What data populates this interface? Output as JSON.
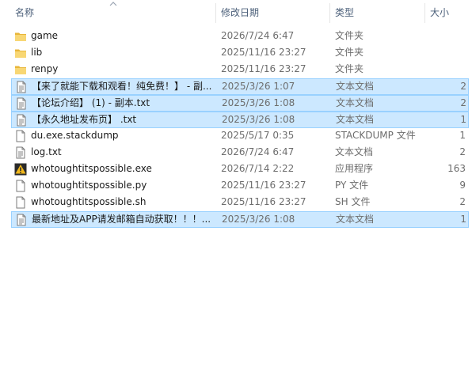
{
  "columns": {
    "name": "名称",
    "date": "修改日期",
    "type": "类型",
    "size": "大小"
  },
  "files": [
    {
      "icon": "folder-icon",
      "name": "game",
      "date": "2026/7/24 6:47",
      "type": "文件夹",
      "size": "",
      "selected": false
    },
    {
      "icon": "folder-icon",
      "name": "lib",
      "date": "2025/11/16 23:27",
      "type": "文件夹",
      "size": "",
      "selected": false
    },
    {
      "icon": "folder-icon",
      "name": "renpy",
      "date": "2025/11/16 23:27",
      "type": "文件夹",
      "size": "",
      "selected": false
    },
    {
      "icon": "text-document-icon",
      "name": "【来了就能下载和观看！纯免费！】 - 副...",
      "date": "2025/3/26 1:07",
      "type": "文本文档",
      "size": "2",
      "selected": true
    },
    {
      "icon": "text-document-icon",
      "name": "【论坛介绍】 (1) - 副本.txt",
      "date": "2025/3/26 1:08",
      "type": "文本文档",
      "size": "2",
      "selected": true
    },
    {
      "icon": "text-document-icon",
      "name": "【永久地址发布页】 .txt",
      "date": "2025/3/26 1:08",
      "type": "文本文档",
      "size": "1",
      "selected": true
    },
    {
      "icon": "file-icon",
      "name": "du.exe.stackdump",
      "date": "2025/5/17 0:35",
      "type": "STACKDUMP 文件",
      "size": "1",
      "selected": false
    },
    {
      "icon": "text-document-icon",
      "name": "log.txt",
      "date": "2026/7/24 6:47",
      "type": "文本文档",
      "size": "2",
      "selected": false
    },
    {
      "icon": "app-warning-icon",
      "name": "whotoughtitspossible.exe",
      "date": "2026/7/14 2:22",
      "type": "应用程序",
      "size": "163",
      "selected": false
    },
    {
      "icon": "file-icon",
      "name": "whotoughtitspossible.py",
      "date": "2025/11/16 23:27",
      "type": "PY 文件",
      "size": "9",
      "selected": false
    },
    {
      "icon": "file-icon",
      "name": "whotoughtitspossible.sh",
      "date": "2025/11/16 23:27",
      "type": "SH 文件",
      "size": "2",
      "selected": false
    },
    {
      "icon": "text-document-icon",
      "name": "最新地址及APP请发邮箱自动获取！！！...",
      "date": "2025/3/26 1:08",
      "type": "文本文档",
      "size": "1",
      "selected": true
    }
  ]
}
